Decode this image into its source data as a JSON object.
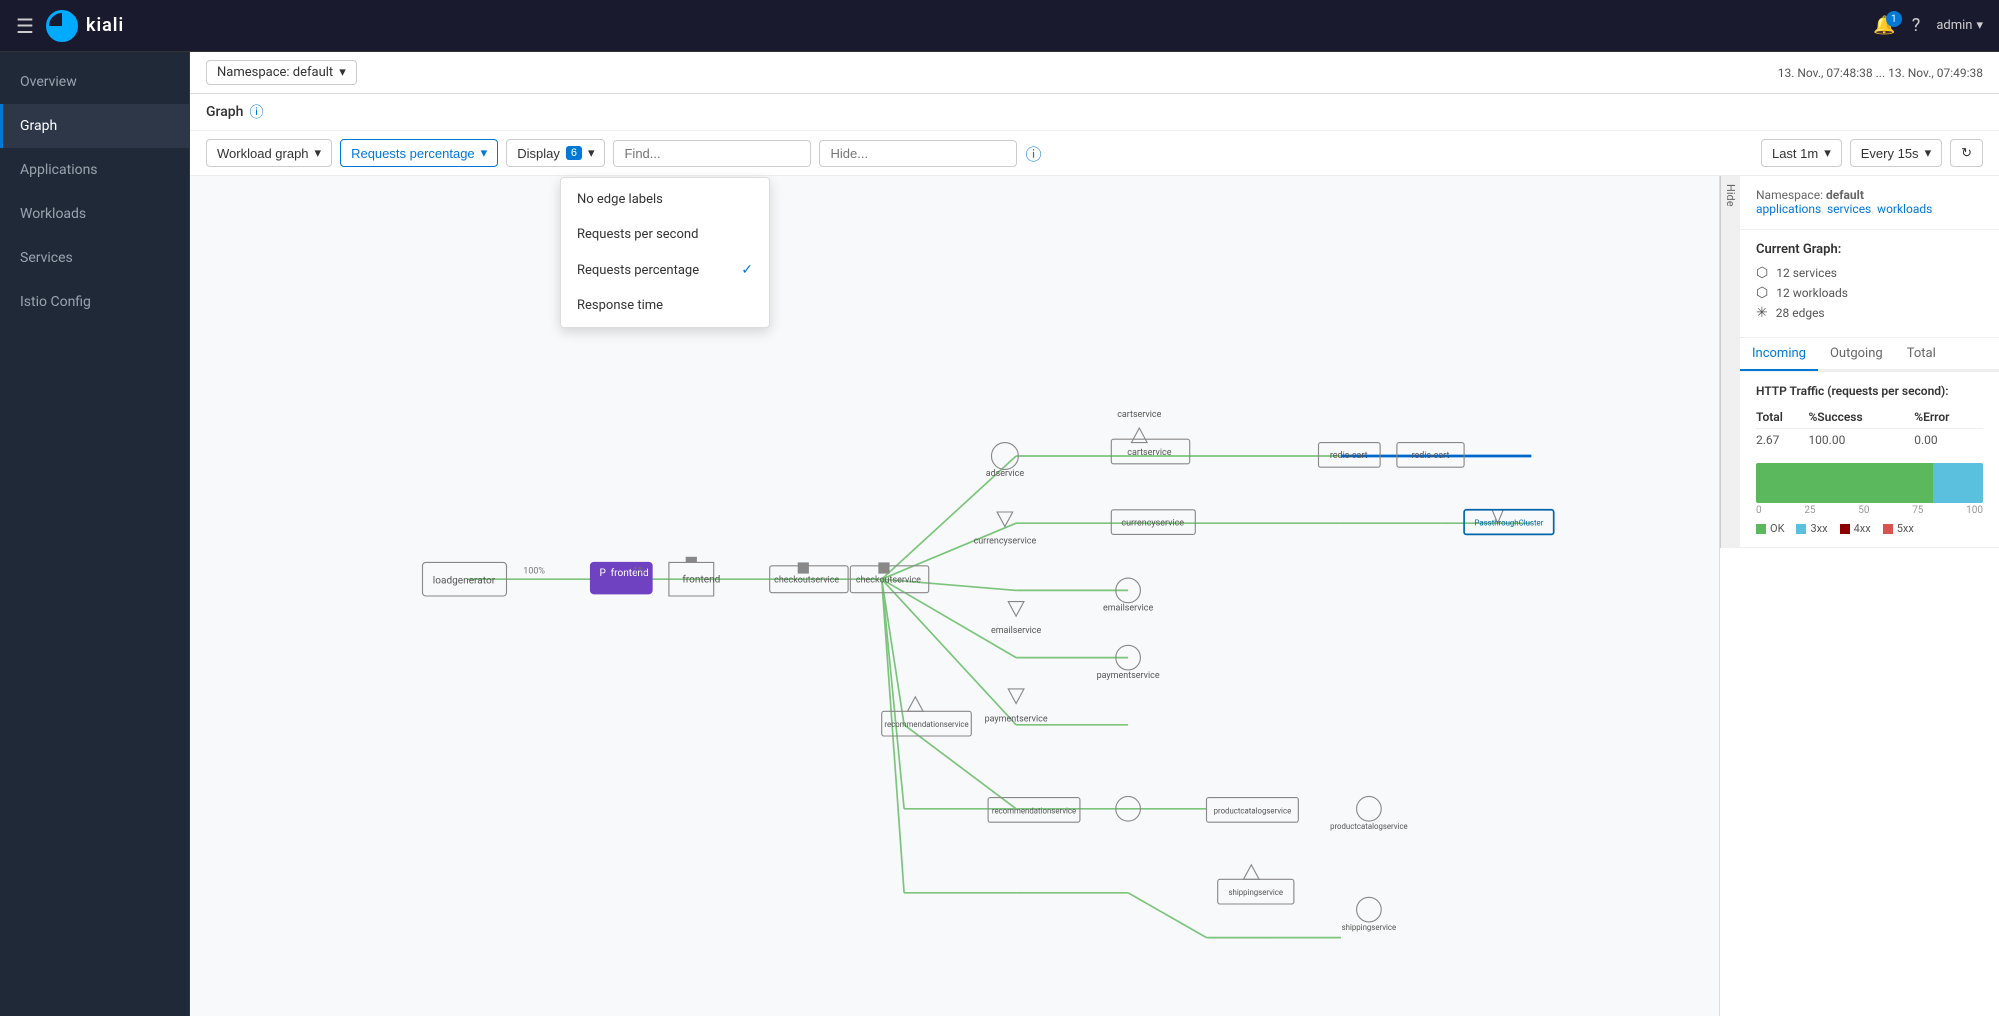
{
  "topnav": {
    "logo_text": "kiali",
    "bell_count": "1",
    "user": "admin"
  },
  "sidebar": {
    "items": [
      {
        "id": "overview",
        "label": "Overview",
        "active": false
      },
      {
        "id": "graph",
        "label": "Graph",
        "active": true
      },
      {
        "id": "applications",
        "label": "Applications",
        "active": false
      },
      {
        "id": "workloads",
        "label": "Workloads",
        "active": false
      },
      {
        "id": "services",
        "label": "Services",
        "active": false
      },
      {
        "id": "istio-config",
        "label": "Istio Config",
        "active": false
      }
    ]
  },
  "header": {
    "namespace_label": "Namespace: default",
    "date_range": "13. Nov., 07:48:38 ... 13. Nov., 07:49:38"
  },
  "graph_section": {
    "title": "Graph",
    "info_tooltip": "Graph info"
  },
  "toolbar": {
    "workload_graph_label": "Workload graph",
    "requests_percentage_label": "Requests percentage",
    "display_label": "Display",
    "display_count": "6",
    "find_placeholder": "Find...",
    "hide_placeholder": "Hide...",
    "last_label": "Last 1m",
    "every_label": "Every 15s"
  },
  "dropdown": {
    "options": [
      {
        "id": "no-edge-labels",
        "label": "No edge labels",
        "selected": false
      },
      {
        "id": "requests-per-second",
        "label": "Requests per second",
        "selected": false
      },
      {
        "id": "requests-percentage",
        "label": "Requests percentage",
        "selected": true
      },
      {
        "id": "response-time",
        "label": "Response time",
        "selected": false
      }
    ]
  },
  "right_panel": {
    "namespace_label": "Namespace:",
    "namespace_value": "default",
    "namespace_links": [
      "applications",
      "services",
      "workloads"
    ],
    "current_graph_title": "Current Graph:",
    "graph_stats": [
      {
        "icon": "service",
        "text": "12 services"
      },
      {
        "icon": "workload",
        "text": "12 workloads"
      },
      {
        "icon": "edge",
        "text": "28 edges"
      }
    ],
    "tabs": [
      {
        "id": "incoming",
        "label": "Incoming",
        "active": true
      },
      {
        "id": "outgoing",
        "label": "Outgoing",
        "active": false
      },
      {
        "id": "total",
        "label": "Total",
        "active": false
      }
    ],
    "traffic_title": "HTTP Traffic (requests per second):",
    "traffic_headers": [
      "Total",
      "%Success",
      "%Error"
    ],
    "traffic_values": [
      "2.67",
      "100.00",
      "0.00"
    ],
    "bar_green_pct": 78,
    "bar_blue_pct": 22,
    "bar_axis": [
      "0",
      "25",
      "50",
      "75",
      "100"
    ],
    "legend": [
      {
        "color": "green",
        "label": "OK"
      },
      {
        "color": "blue",
        "label": "3xx"
      },
      {
        "color": "darkred",
        "label": "4xx"
      },
      {
        "color": "red",
        "label": "5xx"
      }
    ]
  }
}
